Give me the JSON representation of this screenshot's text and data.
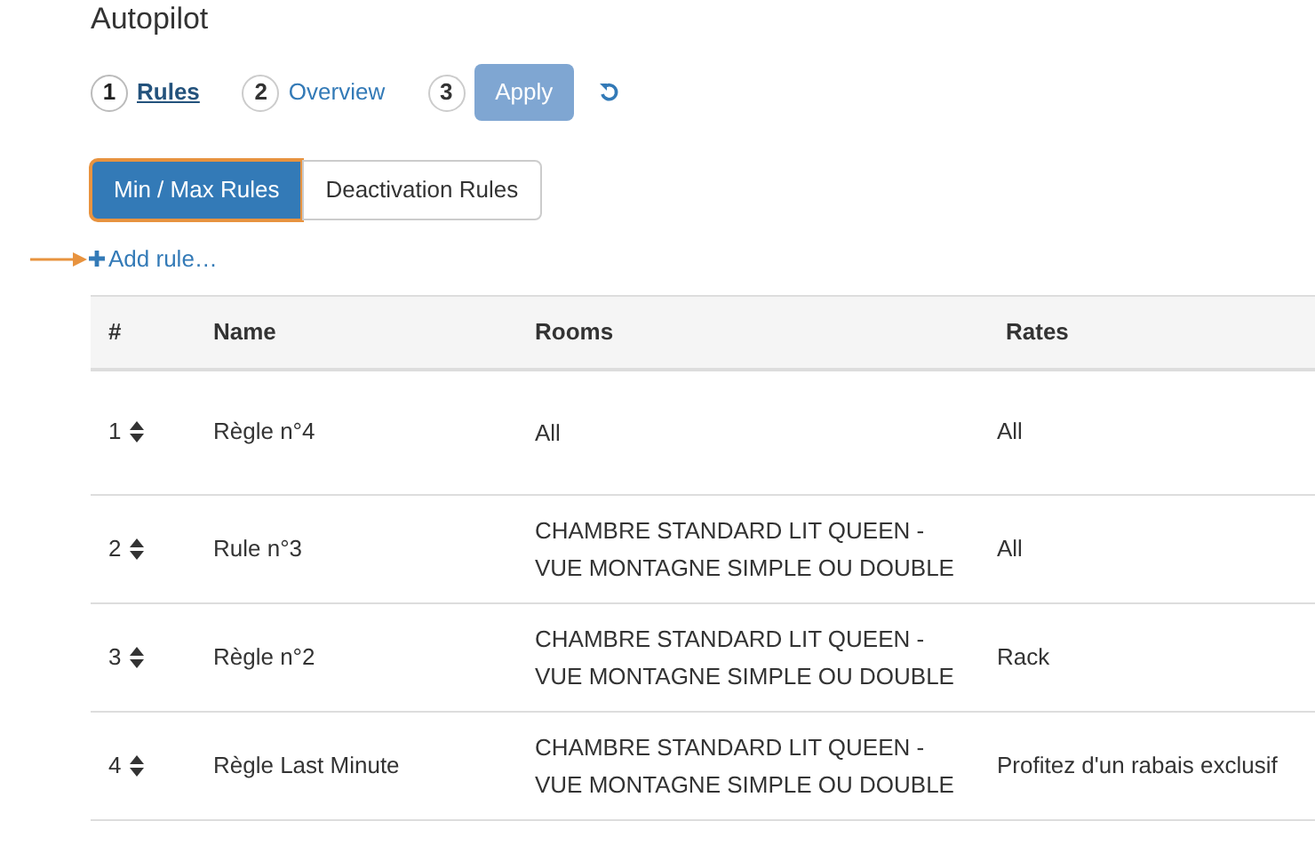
{
  "title": "Autopilot",
  "steps": [
    {
      "number": "1",
      "label": "Rules",
      "kind": "link",
      "selected": true
    },
    {
      "number": "2",
      "label": "Overview",
      "kind": "link",
      "selected": false
    },
    {
      "number": "3",
      "label": "Apply",
      "kind": "button",
      "selected": false,
      "disabled": true
    }
  ],
  "toggle": [
    {
      "label": "Min / Max Rules",
      "selected": true
    },
    {
      "label": "Deactivation Rules",
      "selected": false
    }
  ],
  "add_rule": "Add rule…",
  "table": {
    "columns": [
      "#",
      "Name",
      "Rooms",
      "Rates"
    ],
    "rows": [
      {
        "rank": "1",
        "name": "Règle n°4",
        "rooms": "All",
        "rates": "All"
      },
      {
        "rank": "2",
        "name": "Rule n°3",
        "rooms": "CHAMBRE STANDARD LIT QUEEN - VUE MONTAGNE SIMPLE OU DOUBLE",
        "rates": "All"
      },
      {
        "rank": "3",
        "name": "Règle n°2",
        "rooms": "CHAMBRE STANDARD LIT QUEEN - VUE MONTAGNE SIMPLE OU DOUBLE",
        "rates": "Rack"
      },
      {
        "rank": "4",
        "name": "Règle Last Minute",
        "rooms": "CHAMBRE STANDARD LIT QUEEN - VUE MONTAGNE SIMPLE OU DOUBLE",
        "rates": "Profitez d'un rabais exclusif"
      }
    ]
  }
}
